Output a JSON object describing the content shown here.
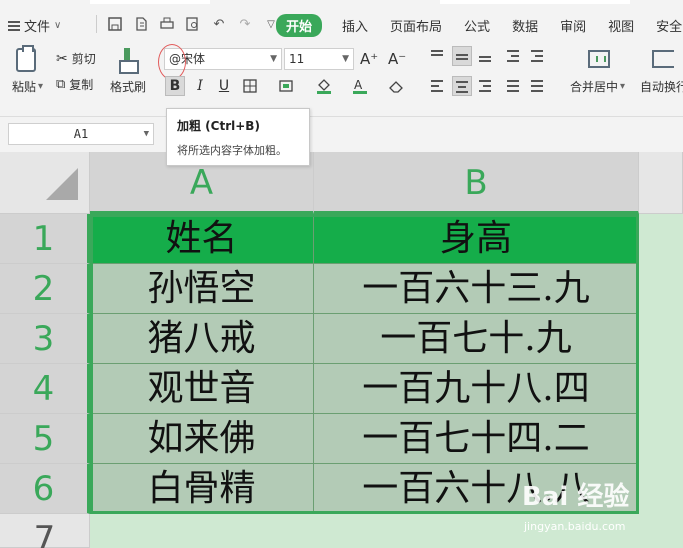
{
  "menubar": {
    "file_label": "文件",
    "tabs": [
      "开始",
      "插入",
      "页面布局",
      "公式",
      "数据",
      "审阅",
      "视图",
      "安全"
    ],
    "active_tab": "开始"
  },
  "ribbon": {
    "paste_label": "粘贴",
    "cut_label": "剪切",
    "copy_label": "复制",
    "format_painter_label": "格式刷",
    "font_name": "@宋体",
    "font_size": "11",
    "bold_glyph": "B",
    "italic_glyph": "I",
    "underline_glyph": "U",
    "grow_font_glyph": "A⁺",
    "shrink_font_glyph": "A⁻",
    "merge_label": "合并居中",
    "wrap_label": "自动换行"
  },
  "tooltip": {
    "title": "加粗 (Ctrl+B)",
    "description": "将所选内容字体加粗。"
  },
  "formula_bar": {
    "name_box": "A1"
  },
  "sheet": {
    "columns": [
      "A",
      "B"
    ],
    "rows": [
      "1",
      "2",
      "3",
      "4",
      "5",
      "6",
      "7"
    ],
    "header": [
      "姓名",
      "身高"
    ],
    "data": [
      [
        "孙悟空",
        "一百六十三.九"
      ],
      [
        "猪八戒",
        "一百七十.九"
      ],
      [
        "观世音",
        "一百九十八.四"
      ],
      [
        "如来佛",
        "一百七十四.二"
      ],
      [
        "白骨精",
        "一百六十八.八"
      ]
    ]
  },
  "watermark": {
    "brand": "Bai 经验",
    "url": "jingyan.baidu.com"
  },
  "colors": {
    "accent": "#3aa85a",
    "header_fill": "#15ad4a",
    "body_fill": "#b3cbb6"
  }
}
